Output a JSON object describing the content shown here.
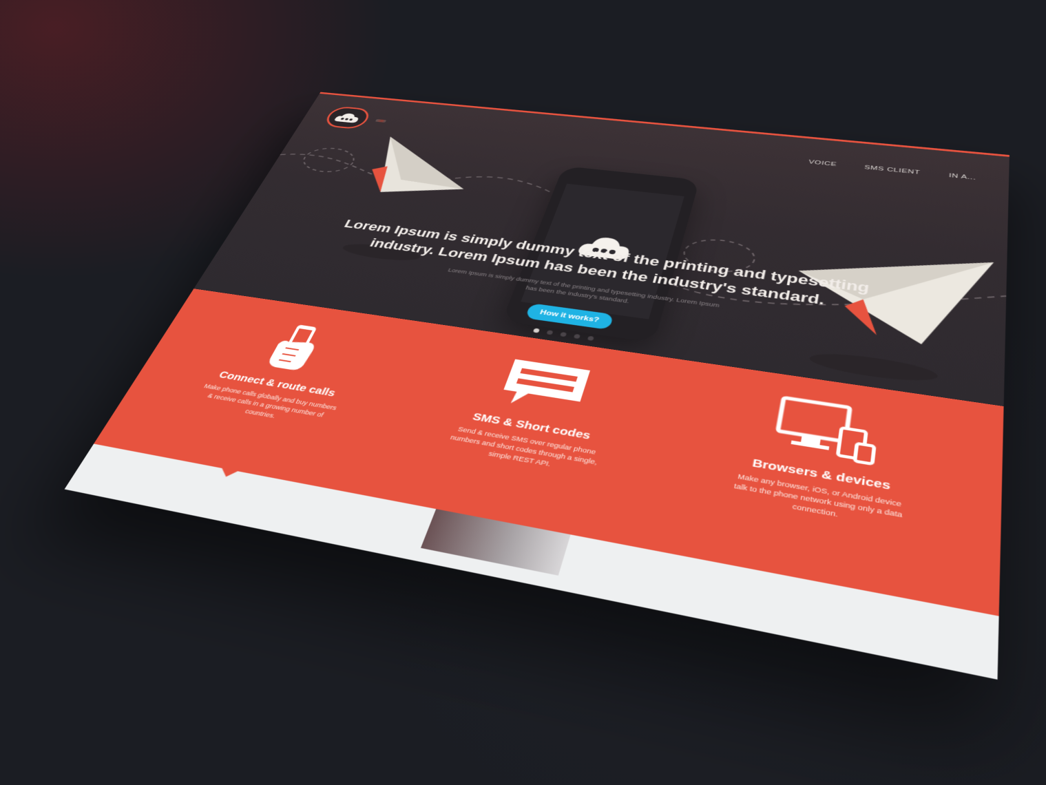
{
  "brand": {
    "name": "",
    "accent": "#e7533f",
    "dark": "#302b30",
    "cta_color": "#1fb3e4"
  },
  "nav": {
    "items": [
      "VOICE",
      "SMS CLIENT",
      "IN A..."
    ]
  },
  "hero": {
    "title": "Lorem Ipsum is simply dummy text of the printing and typesetting industry. Lorem Ipsum has been the industry's standard.",
    "subtitle": "Lorem Ipsum is simply dummy text of the printing and typesetting industry. Lorem Ipsum has been the industry's standard.",
    "cta_label": "How it works?",
    "slides_count": 5,
    "active_slide": 1
  },
  "features": [
    {
      "title": "Connect & route calls",
      "text": "Make phone calls globally and buy numbers & receive calls in a growing number of countries.",
      "icon": "phone-hand-icon"
    },
    {
      "title": "SMS & Short codes",
      "text": "Send & receive SMS over regular phone numbers and short codes through a single, simple REST API.",
      "icon": "chat-bubble-icon"
    },
    {
      "title": "Browsers & devices",
      "text": "Make any browser, iOS, or Android device talk to the phone network using only a data connection.",
      "icon": "devices-icon"
    }
  ]
}
